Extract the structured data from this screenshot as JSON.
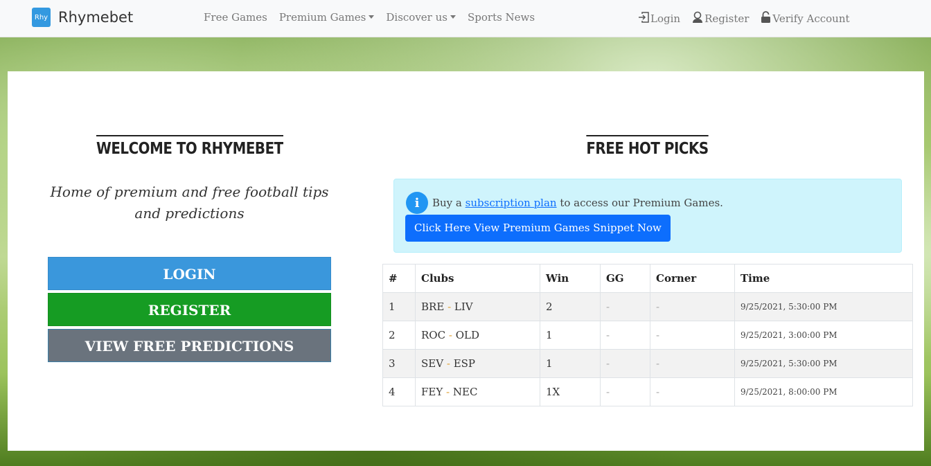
{
  "brand": {
    "logo_text": "Rhy",
    "name": "Rhymebet"
  },
  "nav": {
    "links": [
      {
        "label": "Free Games",
        "dropdown": false
      },
      {
        "label": "Premium Games",
        "dropdown": true
      },
      {
        "label": "Discover us",
        "dropdown": true
      },
      {
        "label": "Sports News",
        "dropdown": false
      }
    ],
    "right": [
      {
        "label": "Login",
        "icon": "login-icon"
      },
      {
        "label": "Register",
        "icon": "register-icon"
      },
      {
        "label": "Verify Account",
        "icon": "lock-icon"
      }
    ]
  },
  "welcome": {
    "title": "WELCOME TO RHYMEBET",
    "tagline": "Home of premium and free football tips and predictions",
    "buttons": {
      "login": "LOGIN",
      "register": "REGISTER",
      "free": "VIEW FREE PREDICTIONS"
    }
  },
  "picks": {
    "title": "FREE HOT PICKS",
    "alert": {
      "prefix": "Buy a",
      "link": "subscription plan",
      "suffix": "to access our Premium Games.",
      "button": "Click Here View Premium Games Snippet Now"
    },
    "headers": [
      "#",
      "Clubs",
      "Win",
      "GG",
      "Corner",
      "Time"
    ],
    "rows": [
      {
        "num": "1",
        "home": "BRE",
        "away": "LIV",
        "win": "2",
        "gg": "-",
        "corner": "-",
        "time": "9/25/2021, 5:30:00 PM"
      },
      {
        "num": "2",
        "home": "ROC",
        "away": "OLD",
        "win": "1",
        "gg": "-",
        "corner": "-",
        "time": "9/25/2021, 3:00:00 PM"
      },
      {
        "num": "3",
        "home": "SEV",
        "away": "ESP",
        "win": "1",
        "gg": "-",
        "corner": "-",
        "time": "9/25/2021, 5:30:00 PM"
      },
      {
        "num": "4",
        "home": "FEY",
        "away": "NEC",
        "win": "1X",
        "gg": "-",
        "corner": "-",
        "time": "9/25/2021, 8:00:00 PM"
      }
    ]
  },
  "colors": {
    "navbar_bg": "#f8f9fa",
    "login_btn": "#3a97dc",
    "register_btn": "#169c23",
    "free_btn": "#6a737d",
    "premium_btn": "#0d6efd",
    "alert_bg": "#cff4fc",
    "info_icon": "#2196f3"
  }
}
